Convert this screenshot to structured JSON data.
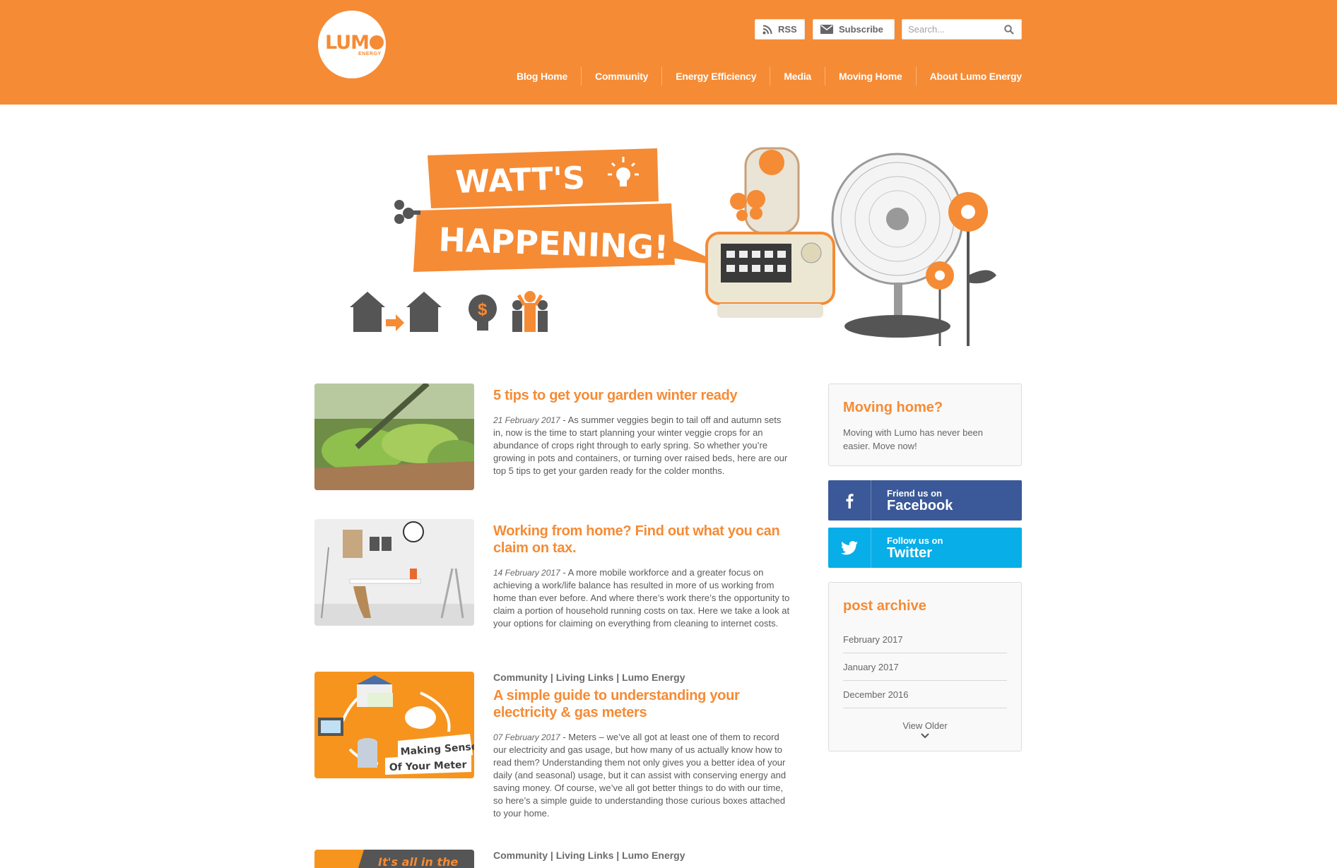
{
  "brand": {
    "name_main": "LUM",
    "name_sub": "ENERGY"
  },
  "header": {
    "rss_label": "RSS",
    "subscribe_label": "Subscribe",
    "search_placeholder": "Search..."
  },
  "nav": {
    "items": [
      "Blog Home",
      "Community",
      "Energy Efficiency",
      "Media",
      "Moving Home",
      "About Lumo Energy"
    ]
  },
  "hero": {
    "line1": "WATT'S",
    "line2": "HAPPENING!"
  },
  "posts": [
    {
      "category": "",
      "title": "5 tips to get your garden winter ready",
      "date": "21 February 2017",
      "excerpt": " - As summer veggies begin to tail off and autumn sets in, now is the time to start planning your winter veggie crops for an abundance of crops right through to early spring. So whether you’re growing in pots and containers, or turning over raised beds, here are our top 5 tips to get your garden ready for the colder months."
    },
    {
      "category": "",
      "title": "Working from home? Find out what you can claim on tax.",
      "date": "14 February 2017",
      "excerpt": " - A more mobile workforce and a greater focus on achieving a work/life balance has resulted in more of us working from home than ever before. And where there’s work there’s the opportunity to claim a portion of household running costs on tax. Here we take a look at your options for claiming on everything from cleaning to internet costs."
    },
    {
      "category": "Community | Living Links | Lumo Energy",
      "title": "A simple guide to understanding your electricity & gas meters",
      "date": "07 February 2017",
      "excerpt": " - Meters – we’ve all got at least one of them to record our electricity and gas usage, but how many of us actually know how to read them? Understanding them not only gives you a better idea of your daily (and seasonal) usage, but it can assist with conserving energy and saving money. Of course, we’ve all got better things to do with our time, so here’s a simple guide to understanding those curious boxes attached to your home.",
      "thumb_line1": "Making Sense",
      "thumb_line2": "Of Your Meter"
    },
    {
      "category": "Community | Living Links | Lumo Energy",
      "thumb_line1": "It's all in the"
    }
  ],
  "sidebar": {
    "moving": {
      "title": "Moving home?",
      "text": "Moving with Lumo has never been easier. Move now!"
    },
    "facebook": {
      "small": "Friend us on",
      "big": "Facebook"
    },
    "twitter": {
      "small": "Follow us on",
      "big": "Twitter"
    },
    "archive": {
      "title": "post archive",
      "months": [
        "February 2017",
        "January 2017",
        "December 2016"
      ],
      "view_older": "View Older"
    }
  },
  "colors": {
    "brand_orange": "#f58b35",
    "facebook": "#3b5998",
    "twitter": "#08aee8"
  }
}
